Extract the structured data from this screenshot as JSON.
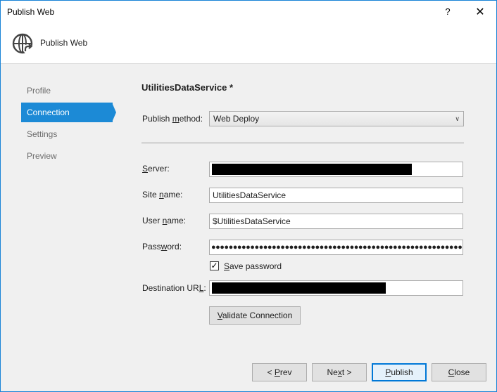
{
  "window": {
    "title": "Publish Web",
    "help_label": "?",
    "close_label": "✕"
  },
  "header": {
    "title": "Publish Web",
    "icon": "globe-publish-icon"
  },
  "sidebar": {
    "items": [
      {
        "label": "Profile",
        "active": false
      },
      {
        "label": "Connection",
        "active": true
      },
      {
        "label": "Settings",
        "active": false
      },
      {
        "label": "Preview",
        "active": false
      }
    ]
  },
  "content": {
    "heading": "UtilitiesDataService *",
    "publish_method": {
      "label_pre": "Publish ",
      "label_u": "m",
      "label_post": "ethod:",
      "value": "Web Deploy"
    },
    "server": {
      "label_pre": "",
      "label_u": "S",
      "label_post": "erver:",
      "value": ""
    },
    "site_name": {
      "label_pre": "Site ",
      "label_u": "n",
      "label_post": "ame:",
      "value": "UtilitiesDataService"
    },
    "user_name": {
      "label_pre": "User ",
      "label_u": "n",
      "label_post": "ame:",
      "value": "$UtilitiesDataService"
    },
    "password": {
      "label_pre": "Pass",
      "label_u": "w",
      "label_post": "ord:",
      "value": "●●●●●●●●●●●●●●●●●●●●●●●●●●●●●●●●●●●●●●●●●●●●●●●●●●●●●●●●●●●●●●●"
    },
    "save_password": {
      "checked": true,
      "check_glyph": "✓",
      "label_pre": "",
      "label_u": "S",
      "label_post": "ave password"
    },
    "destination_url": {
      "label_pre": "Destination UR",
      "label_u": "L",
      "label_post": ":",
      "value": ""
    },
    "validate_button": {
      "label_pre": "",
      "label_u": "V",
      "label_post": "alidate Connection"
    }
  },
  "footer": {
    "prev": {
      "label_pre": "< ",
      "label_u": "P",
      "label_post": "rev"
    },
    "next": {
      "label_pre": "Ne",
      "label_u": "x",
      "label_post": "t >"
    },
    "publish": {
      "label_pre": "",
      "label_u": "P",
      "label_post": "ublish"
    },
    "close": {
      "label_pre": "",
      "label_u": "C",
      "label_post": "lose"
    }
  },
  "colors": {
    "accent": "#1c8ad6",
    "window_border": "#1883d7",
    "dialog_bg": "#f0f0f0"
  }
}
